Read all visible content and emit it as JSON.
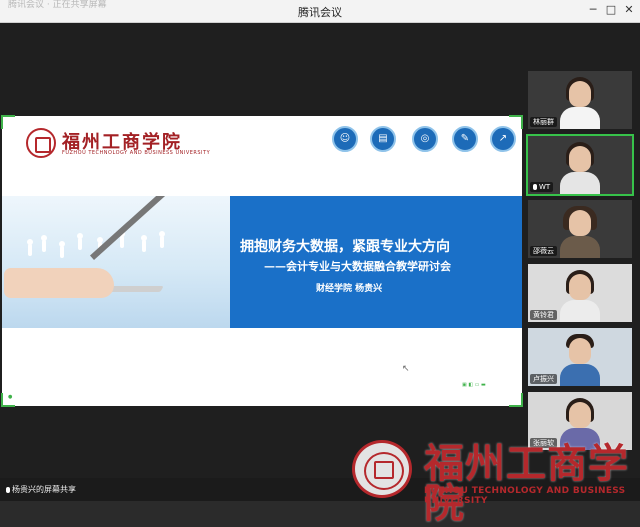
{
  "window": {
    "title": "腾讯会议",
    "ghost_text": "腾讯会议 · 正在共享屏幕",
    "minimize": "─",
    "maximize": "□",
    "close": "✕"
  },
  "slide": {
    "school_cn": "福州工商学院",
    "school_en": "FUZHOU TECHNOLOGY AND BUSINESS UNIVERSITY",
    "banner_title": "拥抱财务大数据，紧跟专业大方向",
    "banner_subtitle": "——会计专业与大数据融合教学研讨会",
    "banner_author": "财经学院  杨贵兴",
    "top_icons": [
      "people-icon",
      "chart-icon",
      "target-icon",
      "pen-icon",
      "trend-icon"
    ]
  },
  "participants": [
    {
      "name": "林丽群",
      "active": false,
      "shirt": "#f4f4f4"
    },
    {
      "name": "WT",
      "active": true,
      "shirt": "#e5e5e5",
      "mic": true
    },
    {
      "name": "邵薇云",
      "active": false,
      "shirt": "#6b5b4a"
    },
    {
      "name": "黄铃君",
      "active": false,
      "shirt": "#ececec"
    },
    {
      "name": "卢振兴",
      "active": false,
      "shirt": "#3b6fb0"
    },
    {
      "name": "张丽软",
      "active": false,
      "shirt": "#6a6aa8"
    }
  ],
  "bottom": {
    "share_label": "杨贵兴的屏幕共享"
  },
  "watermark": {
    "school_cn": "福州工商学院",
    "school_en": "FUZHOU TECHNOLOGY AND BUSINESS UNIVERSITY"
  }
}
